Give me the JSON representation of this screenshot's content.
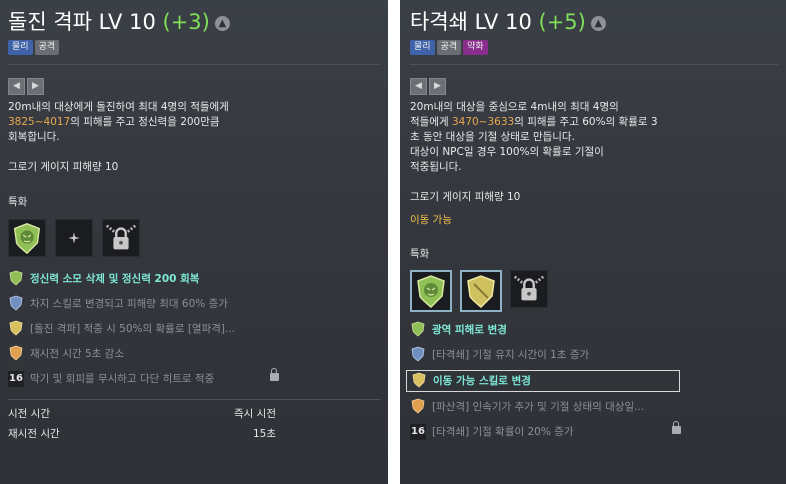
{
  "panel1": {
    "title_name": "돌진 격파",
    "title_lv": "LV 10",
    "title_plus": "(+3)",
    "tags": [
      "물리",
      "공격"
    ],
    "desc_lines": [
      [
        "20m내의 대상에게 돌진하여 최대 4명의 적들에게",
        ""
      ],
      [
        "",
        "3825~4017",
        "의 피해를 주고 정신력을 200만큼"
      ],
      [
        "회복합니다."
      ]
    ],
    "desc1": "20m내의 대상에게 돌진하여 최대 4명의 적들에게",
    "desc2_hl": "3825~4017",
    "desc2_rest": "의 피해를 주고 정신력을 200만큼",
    "desc3": "회복합니다.",
    "gauge": "그로기 게이지 피해량 10",
    "spec_label": "특화",
    "traits": [
      "정신력 소모 삭제 및 정신력 200 회복",
      "차지 스킬로 변경되고 피해량 최대 60% 증가",
      "[돌진 격파] 적중 시 50%의 확률로 [열파격]...",
      "재시전 시간 5초 감소",
      "막기 및 회피를 무시하고 다단 히트로 적중"
    ],
    "trait5_num": "16",
    "cast_label": "시전 시간",
    "cast_value": "즉시 시전",
    "cooldown_label": "재시전 시간",
    "cooldown_value": "15초"
  },
  "panel2": {
    "title_name": "타격쇄",
    "title_lv": "LV 10",
    "title_plus": "(+5)",
    "tags": [
      "물리",
      "공격",
      "약화"
    ],
    "desc1": "20m내의 대상을 중심으로 4m내의 최대 4명의",
    "desc2_pre": "적들에게 ",
    "desc2_hl": "3470~3633",
    "desc2_rest": "의 피해를 주고 60%의 확률로 3",
    "desc3": "초 동안 대상을 기절 상태로 만듭니다.",
    "desc4": "대상이 NPC일 경우 100%의 확률로 기절이",
    "desc5": "적중됩니다.",
    "gauge": "그로기 게이지 피해량 10",
    "movable": "이동 가능",
    "spec_label": "특화",
    "traits": [
      "광역 피해로 변경",
      "[타격쇄] 기절 유지 시간이 1초 증가",
      "이동 가능 스킬로 변경",
      "[파산격] 인속기가 추가 및 기절 상태의 대상일...",
      "[타격쇄] 기절 확률이 20% 증가"
    ],
    "trait5_num": "16"
  },
  "colors": {
    "accent_plus": "#7fe05a",
    "damage": "#e8a94e",
    "trait_active": "#7fe8d6",
    "movable": "#f2c048"
  }
}
